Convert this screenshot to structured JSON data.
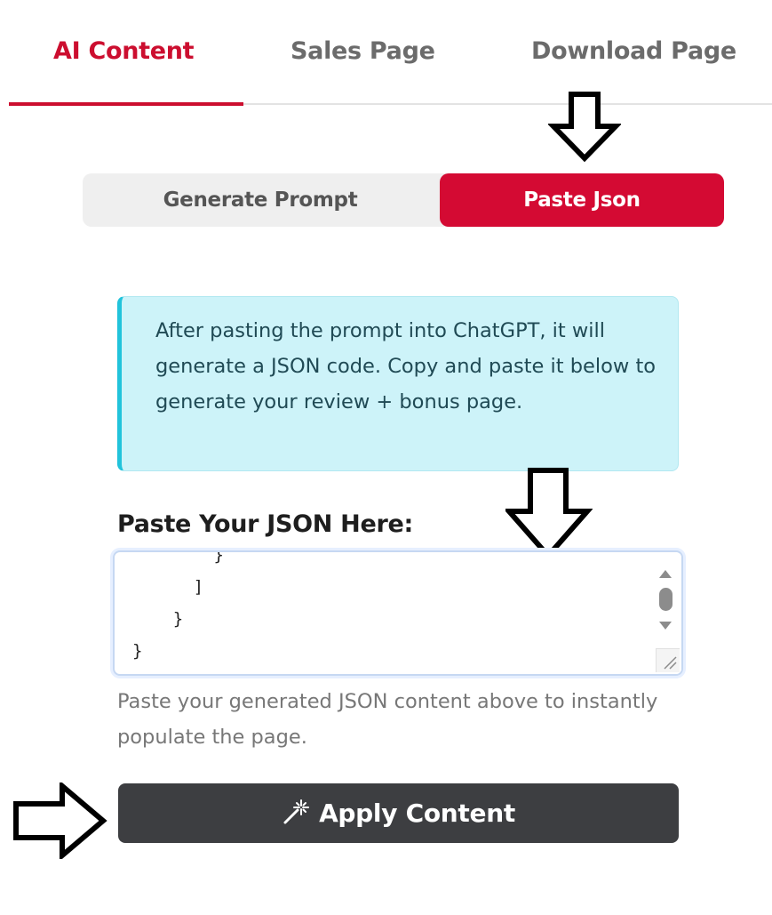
{
  "tabs": [
    {
      "label": "AI Content",
      "active": true
    },
    {
      "label": "Sales Page",
      "active": false
    },
    {
      "label": "Download Page",
      "active": false
    }
  ],
  "mode_toggle": {
    "generate_label": "Generate Prompt",
    "paste_label": "Paste Json",
    "selected": "Paste Json"
  },
  "info_message": "After pasting the prompt into ChatGPT, it will generate a JSON code. Copy and paste it below to generate your review + bonus page.",
  "json_field": {
    "label": "Paste Your JSON Here:",
    "value": "        }\n      ]\n    }\n}",
    "help_text": "Paste your generated JSON content above to instantly populate the page."
  },
  "apply_button": {
    "label": "Apply Content",
    "icon": "magic-wand-icon"
  },
  "annotations": {
    "arrow_icon": "outlined-arrow-icon"
  },
  "colors": {
    "accent": "#cc0e2f",
    "toggle_active": "#d40a33",
    "info_background": "#cdf3f9",
    "info_border": "#21c3db",
    "button_dark": "#3d3e41"
  }
}
